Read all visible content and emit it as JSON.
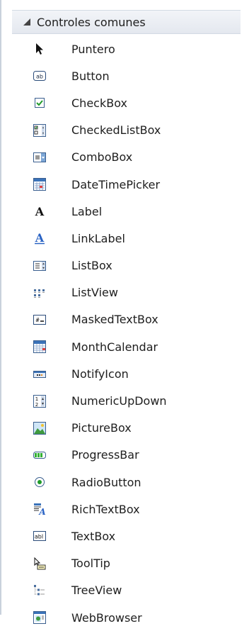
{
  "toolbox": {
    "category": {
      "label": "Controles comunes",
      "expanded": true
    },
    "items": [
      {
        "label": "Puntero",
        "icon": "pointer-icon"
      },
      {
        "label": "Button",
        "icon": "button-icon"
      },
      {
        "label": "CheckBox",
        "icon": "checkbox-icon"
      },
      {
        "label": "CheckedListBox",
        "icon": "checked-list-box-icon"
      },
      {
        "label": "ComboBox",
        "icon": "combo-box-icon"
      },
      {
        "label": "DateTimePicker",
        "icon": "date-time-picker-icon"
      },
      {
        "label": "Label",
        "icon": "label-icon"
      },
      {
        "label": "LinkLabel",
        "icon": "link-label-icon"
      },
      {
        "label": "ListBox",
        "icon": "list-box-icon"
      },
      {
        "label": "ListView",
        "icon": "list-view-icon"
      },
      {
        "label": "MaskedTextBox",
        "icon": "masked-text-box-icon"
      },
      {
        "label": "MonthCalendar",
        "icon": "month-calendar-icon"
      },
      {
        "label": "NotifyIcon",
        "icon": "notify-icon-icon"
      },
      {
        "label": "NumericUpDown",
        "icon": "numeric-up-down-icon"
      },
      {
        "label": "PictureBox",
        "icon": "picture-box-icon"
      },
      {
        "label": "ProgressBar",
        "icon": "progress-bar-icon"
      },
      {
        "label": "RadioButton",
        "icon": "radio-button-icon"
      },
      {
        "label": "RichTextBox",
        "icon": "rich-text-box-icon"
      },
      {
        "label": "TextBox",
        "icon": "text-box-icon"
      },
      {
        "label": "ToolTip",
        "icon": "tooltip-icon"
      },
      {
        "label": "TreeView",
        "icon": "tree-view-icon"
      },
      {
        "label": "WebBrowser",
        "icon": "web-browser-icon"
      }
    ],
    "colors": {
      "accent": "#3b73b9",
      "text": "#1e1e1e",
      "header_bg": "#e8ecf2"
    }
  }
}
